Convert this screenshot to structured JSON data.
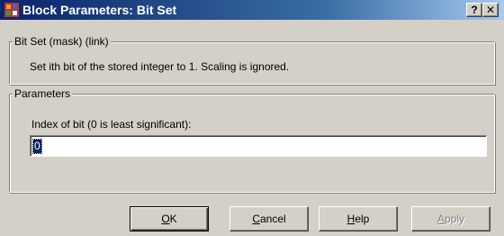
{
  "window": {
    "title": "Block Parameters: Bit Set",
    "help_button": "?",
    "close_button": "✕"
  },
  "mask_group": {
    "legend": "Bit Set (mask) (link)",
    "description": "Set ith bit of the stored integer to 1.  Scaling is ignored."
  },
  "parameters_group": {
    "legend": "Parameters",
    "field_label": "Index of bit (0 is least significant):",
    "field_value": "0"
  },
  "buttons": {
    "ok_label_accel": "O",
    "ok_label_rest": "K",
    "cancel_label_accel": "C",
    "cancel_label_rest": "ancel",
    "help_label_accel": "H",
    "help_label_rest": "elp",
    "apply_label_accel": "A",
    "apply_label_rest": "pply"
  },
  "colors": {
    "titlebar_start": "#0a246a",
    "titlebar_end": "#a6caf0",
    "face": "#d4d0c8",
    "selection": "#0a246a"
  },
  "icons": {
    "app": "simulink-block-icon",
    "help": "question-mark-icon",
    "close": "close-icon"
  }
}
